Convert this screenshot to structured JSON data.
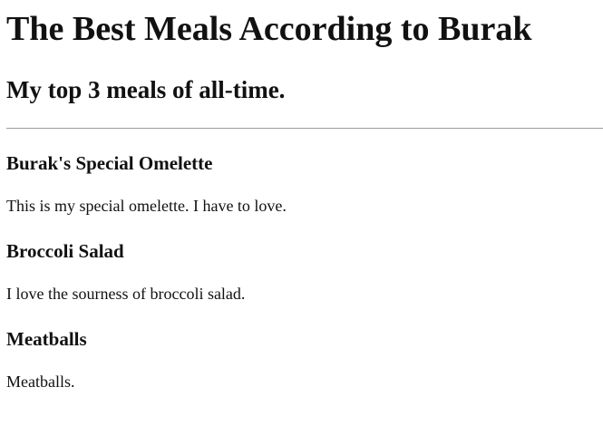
{
  "page": {
    "title": "The Best Meals According to Burak",
    "subtitle": "My top 3 meals of all-time."
  },
  "meals": [
    {
      "name": "Burak's Special Omelette",
      "description": "This is my special omelette. I have to love."
    },
    {
      "name": "Broccoli Salad",
      "description": "I love the sourness of broccoli salad."
    },
    {
      "name": "Meatballs",
      "description": "Meatballs."
    }
  ],
  "colors": {
    "text": "#111111",
    "divider": "#9c9c9c",
    "background": "#ffffff"
  }
}
